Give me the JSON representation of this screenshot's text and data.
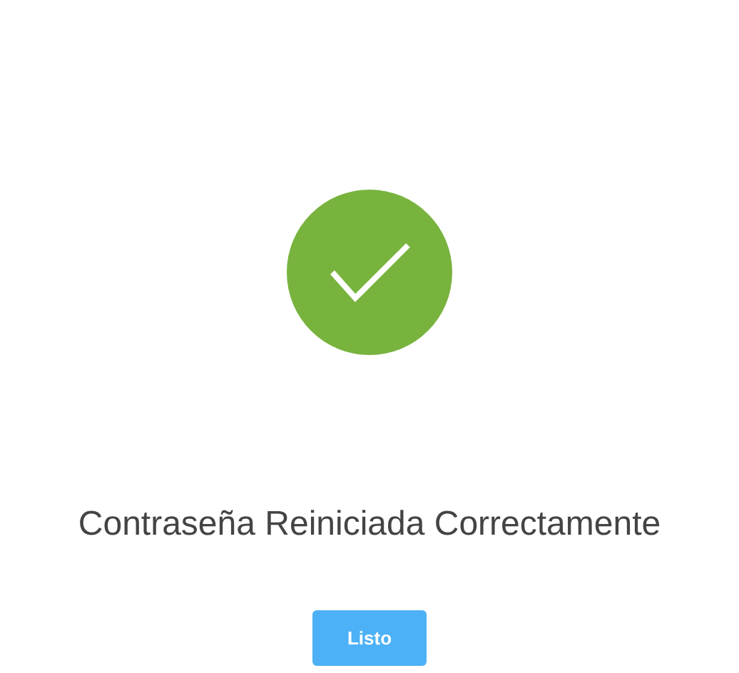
{
  "message": "Contraseña Reiniciada Correctamente",
  "button": {
    "label": "Listo"
  }
}
